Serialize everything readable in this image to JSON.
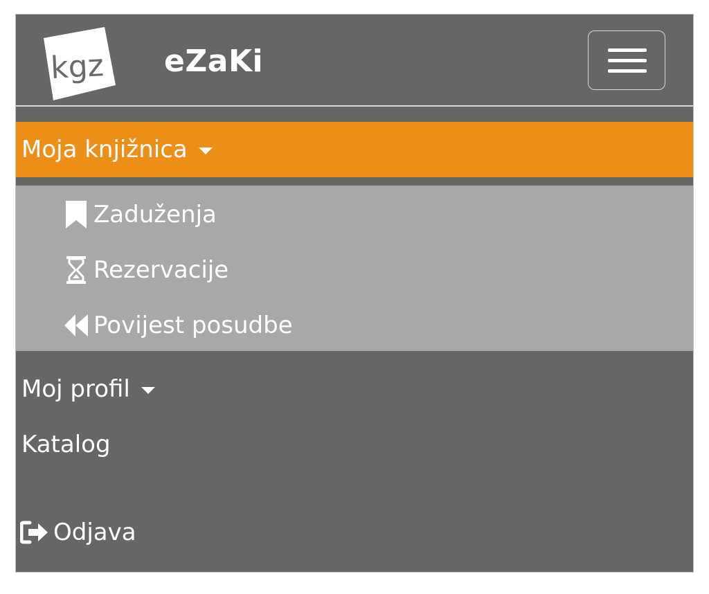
{
  "header": {
    "logo_text": "kgz",
    "brand": "eZaKi",
    "toggler_icon": "hamburger-menu-icon"
  },
  "menu": {
    "my_library": {
      "label": "Moja knjižnica",
      "icon": "caret-down-icon",
      "active_color": "#ec8f19",
      "items": [
        {
          "label": "Zaduženja",
          "icon": "bookmark-icon"
        },
        {
          "label": "Rezervacije",
          "icon": "hourglass-icon"
        },
        {
          "label": "Povijest posudbe",
          "icon": "backward-icon"
        }
      ]
    },
    "my_profile": {
      "label": "Moj profil",
      "icon": "caret-down-icon"
    },
    "catalog": {
      "label": "Katalog"
    },
    "logout": {
      "label": "Odjava",
      "icon": "sign-out-icon"
    }
  },
  "colors": {
    "navbar_bg": "#666666",
    "submenu_bg": "#a9a8a6",
    "accent": "#ec8f19",
    "text": "#ffffff"
  }
}
